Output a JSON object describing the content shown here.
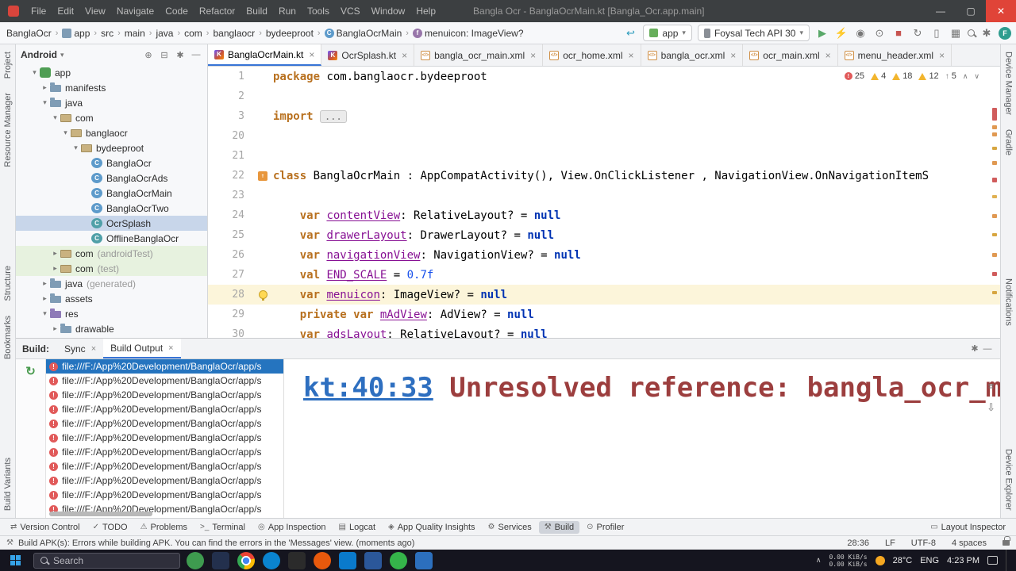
{
  "colors": {
    "accent_blue": "#3874d6",
    "selection_blue": "#2574bf",
    "error_red": "#e15a5a",
    "warning_yellow": "#f2b52e",
    "run_green": "#59a869",
    "keyword_orange": "#b8701e",
    "field_purple": "#871094",
    "number_blue": "#1750eb",
    "console_error_red": "#9c3e3e",
    "caret_line": "#fcf5da",
    "titlebar_bg": "#3c3f41",
    "taskbar_bg": "#15151f"
  },
  "titlebar": {
    "menus": [
      "File",
      "Edit",
      "View",
      "Navigate",
      "Code",
      "Refactor",
      "Build",
      "Run",
      "Tools",
      "VCS",
      "Window",
      "Help"
    ],
    "title": "Bangla Ocr - BanglaOcrMain.kt [Bangla_Ocr.app.main]"
  },
  "navbar": {
    "breadcrumbs": [
      {
        "label": "BanglaOcr"
      },
      {
        "label": "app",
        "icon": "module"
      },
      {
        "label": "src"
      },
      {
        "label": "main"
      },
      {
        "label": "java"
      },
      {
        "label": "com"
      },
      {
        "label": "banglaocr"
      },
      {
        "label": "bydeeproot"
      },
      {
        "label": "BanglaOcrMain",
        "icon": "class"
      },
      {
        "label": "menuicon: ImageView?",
        "icon": "field"
      }
    ],
    "back_arrow_glyph": "↩",
    "run_config": "app",
    "device": "Foysal Tech API 30",
    "actions": [
      {
        "name": "run-button",
        "glyph": "▶",
        "color": "#59a869"
      },
      {
        "name": "apply-changes-icon",
        "glyph": "⚡",
        "color": "#777777"
      },
      {
        "name": "debug-icon",
        "glyph": "◉",
        "color": "#777777"
      },
      {
        "name": "profiler-icon",
        "glyph": "⊙",
        "color": "#777777"
      },
      {
        "name": "stop-icon",
        "glyph": "■",
        "color": "#c75450"
      },
      {
        "name": "sync-project-icon",
        "glyph": "↻",
        "color": "#777777"
      },
      {
        "name": "device-manager-icon",
        "glyph": "▯",
        "color": "#777777"
      },
      {
        "name": "sdk-manager-icon",
        "glyph": "▦",
        "color": "#777777"
      },
      {
        "name": "search-everywhere-icon",
        "glyph": "mag",
        "color": "#777777"
      },
      {
        "name": "settings-icon",
        "glyph": "✱",
        "color": "#777777"
      },
      {
        "name": "profile-avatar",
        "glyph": "F",
        "color": "avatar"
      }
    ]
  },
  "tool_strips": {
    "left_top": [
      "Project",
      "Resource Manager"
    ],
    "left_middle": [
      "Structure",
      "Bookmarks"
    ],
    "left_bottom": [
      "Build Variants"
    ],
    "right_top": [
      "Device Manager",
      "Gradle"
    ],
    "right_middle": [
      "Notifications"
    ],
    "right_bottom": [
      "Device Explorer"
    ]
  },
  "project_panel": {
    "mode": "Android",
    "header_icons": [
      "locate",
      "collapse-all",
      "settings",
      "hide"
    ],
    "tree": [
      {
        "label": "app",
        "indent": 1,
        "icon": "module",
        "chevron": "down"
      },
      {
        "label": "manifests",
        "indent": 2,
        "icon": "folder",
        "chevron": "right"
      },
      {
        "label": "java",
        "indent": 2,
        "icon": "folder",
        "chevron": "down"
      },
      {
        "label": "com",
        "indent": 3,
        "icon": "package",
        "chevron": "down"
      },
      {
        "label": "banglaocr",
        "indent": 4,
        "icon": "package",
        "chevron": "down"
      },
      {
        "label": "bydeeproot",
        "indent": 5,
        "icon": "package",
        "chevron": "down"
      },
      {
        "label": "BanglaOcr",
        "indent": 6,
        "icon": "class"
      },
      {
        "label": "BanglaOcrAds",
        "indent": 6,
        "icon": "class"
      },
      {
        "label": "BanglaOcrMain",
        "indent": 6,
        "icon": "class"
      },
      {
        "label": "BanglaOcrTwo",
        "indent": 6,
        "icon": "class"
      },
      {
        "label": "OcrSplash",
        "indent": 6,
        "icon": "kclass",
        "selected": true
      },
      {
        "label": "OfflineBanglaOcr",
        "indent": 6,
        "icon": "kclass"
      },
      {
        "label": "com",
        "extra": "(androidTest)",
        "indent": 3,
        "icon": "package",
        "chevron": "right",
        "green": true
      },
      {
        "label": "com",
        "extra": "(test)",
        "indent": 3,
        "icon": "package",
        "chevron": "right",
        "green": true
      },
      {
        "label": "java",
        "extra": "(generated)",
        "indent": 2,
        "icon": "folder",
        "chevron": "right"
      },
      {
        "label": "assets",
        "indent": 2,
        "icon": "folder",
        "chevron": "right"
      },
      {
        "label": "res",
        "indent": 2,
        "icon": "folder-res",
        "chevron": "down"
      },
      {
        "label": "drawable",
        "indent": 3,
        "icon": "folder",
        "chevron": "right"
      }
    ]
  },
  "editor": {
    "tabs": [
      {
        "label": "BanglaOcrMain.kt",
        "icon": "kotlin",
        "active": true
      },
      {
        "label": "OcrSplash.kt",
        "icon": "kotlin"
      },
      {
        "label": "bangla_ocr_main.xml",
        "icon": "xml"
      },
      {
        "label": "ocr_home.xml",
        "icon": "xml"
      },
      {
        "label": "bangla_ocr.xml",
        "icon": "xml"
      },
      {
        "label": "ocr_main.xml",
        "icon": "xml"
      },
      {
        "label": "menu_header.xml",
        "icon": "xml"
      }
    ],
    "inspections": [
      {
        "type": "error",
        "count": "25"
      },
      {
        "type": "warning",
        "count": "4"
      },
      {
        "type": "warning",
        "count": "18"
      },
      {
        "type": "warning",
        "count": "12"
      },
      {
        "type": "arrow",
        "count": "5"
      }
    ],
    "lines": [
      {
        "num": "1",
        "tokens": [
          {
            "t": "package ",
            "c": "kw"
          },
          {
            "t": "com.banglaocr.bydeeproot",
            "c": "pl"
          }
        ]
      },
      {
        "num": "2",
        "tokens": []
      },
      {
        "num": "3",
        "tokens": [
          {
            "t": "import ",
            "c": "kw"
          },
          {
            "t": "...",
            "c": "fold"
          }
        ]
      },
      {
        "num": "20",
        "tokens": []
      },
      {
        "num": "21",
        "tokens": []
      },
      {
        "num": "22",
        "gutter": "impl",
        "tokens": [
          {
            "t": "class ",
            "c": "kw"
          },
          {
            "t": "BanglaOcrMain : AppCompatActivity(), View.OnClickListener , NavigationView.OnNavigationItemS",
            "c": "pl"
          }
        ]
      },
      {
        "num": "23",
        "tokens": []
      },
      {
        "num": "24",
        "tokens": [
          {
            "t": "    ",
            "c": "pl"
          },
          {
            "t": "var ",
            "c": "kw"
          },
          {
            "t": "contentView",
            "c": "fld"
          },
          {
            "t": ": RelativeLayout? = ",
            "c": "pl"
          },
          {
            "t": "null",
            "c": "nul"
          }
        ]
      },
      {
        "num": "25",
        "tokens": [
          {
            "t": "    ",
            "c": "pl"
          },
          {
            "t": "var ",
            "c": "kw"
          },
          {
            "t": "drawerLayout",
            "c": "fld"
          },
          {
            "t": ": DrawerLayout? = ",
            "c": "pl"
          },
          {
            "t": "null",
            "c": "nul"
          }
        ]
      },
      {
        "num": "26",
        "tokens": [
          {
            "t": "    ",
            "c": "pl"
          },
          {
            "t": "var ",
            "c": "kw"
          },
          {
            "t": "navigationView",
            "c": "fld"
          },
          {
            "t": ": NavigationView? = ",
            "c": "pl"
          },
          {
            "t": "null",
            "c": "nul"
          }
        ]
      },
      {
        "num": "27",
        "tokens": [
          {
            "t": "    ",
            "c": "pl"
          },
          {
            "t": "val ",
            "c": "kw"
          },
          {
            "t": "END_SCALE",
            "c": "fld"
          },
          {
            "t": " = ",
            "c": "pl"
          },
          {
            "t": "0.7f",
            "c": "num"
          }
        ]
      },
      {
        "num": "28",
        "highlight": true,
        "gutter": "bulb",
        "tokens": [
          {
            "t": "    ",
            "c": "pl"
          },
          {
            "t": "var ",
            "c": "kw"
          },
          {
            "t": "menuicon",
            "c": "fld"
          },
          {
            "t": ": ImageView? = ",
            "c": "pl"
          },
          {
            "t": "null",
            "c": "nul"
          }
        ]
      },
      {
        "num": "29",
        "tokens": [
          {
            "t": "    ",
            "c": "pl"
          },
          {
            "t": "private var ",
            "c": "kw"
          },
          {
            "t": "mAdView",
            "c": "fld"
          },
          {
            "t": ": AdView? = ",
            "c": "pl"
          },
          {
            "t": "null",
            "c": "nul"
          }
        ]
      },
      {
        "num": "30",
        "tokens": [
          {
            "t": "    ",
            "c": "pl"
          },
          {
            "t": "var ",
            "c": "kw"
          },
          {
            "t": "adsLayout",
            "c": "fld"
          },
          {
            "t": ": RelativeLayout? = ",
            "c": "pl"
          },
          {
            "t": "null",
            "c": "nul"
          }
        ]
      }
    ]
  },
  "build_panel": {
    "label": "Build:",
    "tabs": [
      {
        "label": "Sync",
        "active": false
      },
      {
        "label": "Build Output",
        "active": true
      }
    ],
    "errors": [
      "file:///F:/App%20Development/BanglaOcr/app/s",
      "file:///F:/App%20Development/BanglaOcr/app/s",
      "file:///F:/App%20Development/BanglaOcr/app/s",
      "file:///F:/App%20Development/BanglaOcr/app/s",
      "file:///F:/App%20Development/BanglaOcr/app/s",
      "file:///F:/App%20Development/BanglaOcr/app/s",
      "file:///F:/App%20Development/BanglaOcr/app/s",
      "file:///F:/App%20Development/BanglaOcr/app/s",
      "file:///F:/App%20Development/BanglaOcr/app/s",
      "file:///F:/App%20Development/BanglaOcr/app/s",
      "file:///F:/App%20Development/BanglaOcr/app/s",
      "file:///F:/App%20Development/BanglaOcr/app/s"
    ],
    "console": {
      "link": "kt:40:33",
      "message": " Unresolved reference: bangla_ocr_main"
    }
  },
  "toolwindow_bar": {
    "items": [
      {
        "label": "Version Control",
        "icon": "⇄"
      },
      {
        "label": "TODO",
        "icon": "✓"
      },
      {
        "label": "Problems",
        "icon": "⚠"
      },
      {
        "label": "Terminal",
        "icon": ">_"
      },
      {
        "label": "App Inspection",
        "icon": "◎"
      },
      {
        "label": "Logcat",
        "icon": "▤"
      },
      {
        "label": "App Quality Insights",
        "icon": "◈"
      },
      {
        "label": "Services",
        "icon": "⚙"
      },
      {
        "label": "Build",
        "icon": "⚒"
      },
      {
        "label": "Profiler",
        "icon": "⊙"
      }
    ],
    "active": "Build",
    "right": [
      {
        "label": "Layout Inspector",
        "icon": "▭"
      }
    ]
  },
  "statusbar": {
    "message": "Build APK(s): Errors while building APK. You can find the errors in the 'Messages' view. (moments ago)",
    "position": "28:36",
    "line_ending": "LF",
    "encoding": "UTF-8",
    "indent": "4 spaces"
  },
  "taskbar": {
    "search_placeholder": "Search",
    "apps": [
      {
        "name": "plant-app-icon",
        "color": "#3e9b4f",
        "round": true
      },
      {
        "name": "app-icon-dark-blue",
        "color": "#23304d"
      },
      {
        "name": "chrome-icon",
        "type": "chrome"
      },
      {
        "name": "edge-icon",
        "color": "#0a84d0",
        "round": true
      },
      {
        "name": "terminal-app-icon",
        "color": "#2b2b2b"
      },
      {
        "name": "firefox-icon",
        "color": "#e8590c",
        "round": true
      },
      {
        "name": "vscode-icon",
        "color": "#0a7acc"
      },
      {
        "name": "word-icon",
        "color": "#2b579a"
      },
      {
        "name": "whatsapp-icon",
        "color": "#35b44a",
        "round": true
      },
      {
        "name": "android-studio-icon",
        "color": "#2c6fbd"
      }
    ],
    "net_down": "0.00 KiB/s",
    "net_up": "0.00 KiB/s",
    "weather": "28°C",
    "lang": "ENG",
    "time": "4:23 PM"
  }
}
